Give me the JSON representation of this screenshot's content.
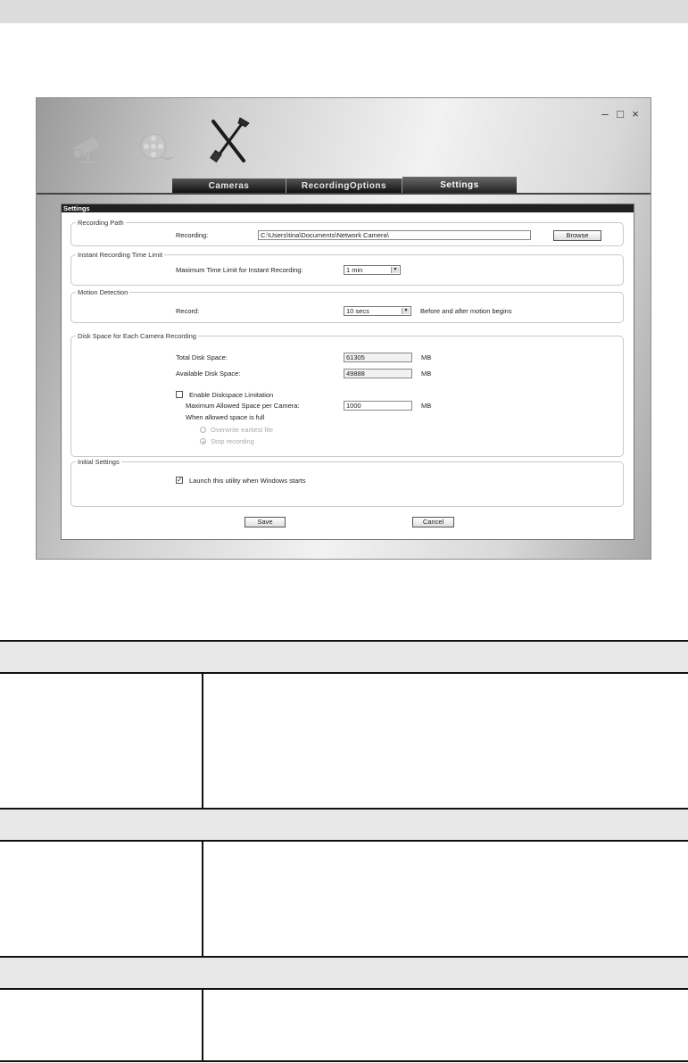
{
  "window": {
    "controls": {
      "minimize": "–",
      "maximize": "□",
      "close": "×"
    },
    "tabs": [
      "Cameras",
      "RecordingOptions",
      "Settings"
    ],
    "active_tab": "Settings"
  },
  "panel": {
    "title": "Settings",
    "recording_path": {
      "group_label": "Recording Path",
      "label": "Recording:",
      "value": "C:\\Users\\tina\\Documents\\Network Camera\\",
      "browse_label": "Browse"
    },
    "instant_limit": {
      "group_label": "Instant Recording Time Limit",
      "label": "Maximum Time Limit for Instant Recording:",
      "value": "1 min"
    },
    "motion": {
      "group_label": "Motion Detection",
      "label": "Record:",
      "value": "10 secs",
      "suffix": "Before and after motion begins"
    },
    "disk": {
      "group_label": "Disk Space for Each Camera Recording",
      "total_label": "Total Disk Space:",
      "total_value": "61305",
      "available_label": "Available Disk Space:",
      "available_value": "49888",
      "unit": "MB",
      "enable_label": "Enable Diskspace Limitation",
      "enable_checked": false,
      "max_label": "Maximum Allowed Space per Camera:",
      "max_value": "1000",
      "full_label": "When allowed space is full",
      "overwrite_label": "Overwrite earliest file",
      "stop_label": "Stop recording"
    },
    "initial": {
      "group_label": "Initial Settings",
      "launch_label": "Launch this utility when Windows starts",
      "launch_checked": true
    },
    "save_label": "Save",
    "cancel_label": "Cancel"
  },
  "icons": [
    "camera-icon",
    "film-reel-icon",
    "tools-icon",
    "minimize-icon",
    "maximize-icon",
    "close-icon",
    "check-icon",
    "dropdown-arrow-icon"
  ]
}
